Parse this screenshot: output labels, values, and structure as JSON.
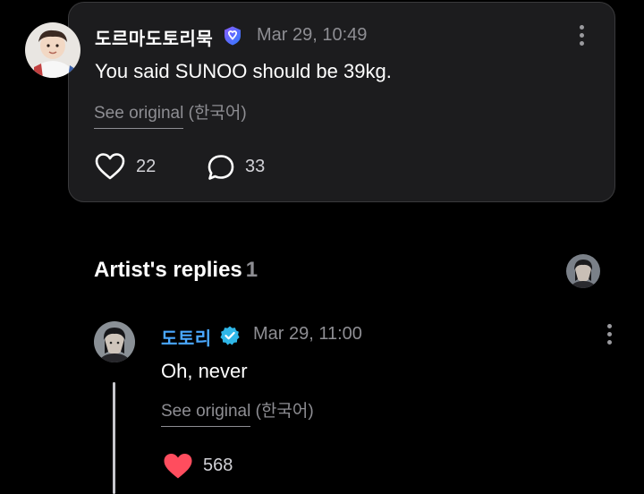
{
  "post": {
    "author": "도르마도토리묵",
    "timestamp": "Mar 29, 10:49",
    "body": "You said SUNOO should be 39kg.",
    "see_original": "See original",
    "original_language": "(한국어)",
    "likes": "22",
    "comments": "33",
    "avatar_icon": "user-avatar",
    "badge_icon": "membership-badge-icon",
    "badge_color": "#5b6bff",
    "like_icon": "heart-outline-icon",
    "comment_icon": "speech-bubble-icon",
    "more_icon": "more-vertical-icon"
  },
  "artist_replies": {
    "title": "Artist's replies",
    "count": "1",
    "avatar_icon": "artist-avatar"
  },
  "reply": {
    "author": "도토리",
    "author_color": "#4aa8ff",
    "timestamp": "Mar 29, 11:00",
    "body": "Oh, never",
    "see_original": "See original",
    "original_language": "(한국어)",
    "likes": "568",
    "like_color": "#ff4d5e",
    "badge_color": "#2fb7e8",
    "badge_icon": "verified-check-icon",
    "like_icon": "heart-filled-icon",
    "more_icon": "more-vertical-icon"
  },
  "colors": {
    "background": "#000000",
    "card": "#1c1c1e",
    "muted_text": "#8e8e93"
  }
}
